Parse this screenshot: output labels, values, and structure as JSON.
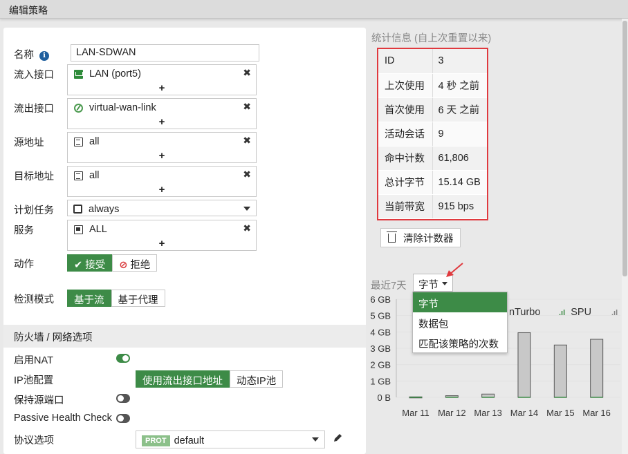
{
  "window": {
    "title": "编辑策略"
  },
  "form": {
    "name_label": "名称",
    "name_value": "LAN-SDWAN",
    "in_iface_label": "流入接口",
    "in_iface_value": "LAN (port5)",
    "out_iface_label": "流出接口",
    "out_iface_value": "virtual-wan-link",
    "src_label": "源地址",
    "src_value": "all",
    "dst_label": "目标地址",
    "dst_value": "all",
    "schedule_label": "计划任务",
    "schedule_value": "always",
    "service_label": "服务",
    "service_value": "ALL",
    "plus": "+",
    "remove": "✖",
    "action_label": "动作",
    "action_accept": "接受",
    "action_deny": "拒绝",
    "inspect_label": "检测模式",
    "inspect_flow": "基于流",
    "inspect_proxy": "基于代理",
    "section_firewall": "防火墙 / 网络选项",
    "nat_label": "启用NAT",
    "nat_on": true,
    "ippool_label": "IP池配置",
    "ippool_outiface": "使用流出接口地址",
    "ippool_dynamic": "动态IP池",
    "keep_src_port_label": "保持源端口",
    "keep_src_port_on": false,
    "passive_health_label": "Passive Health Check",
    "passive_health_on": false,
    "proto_label": "协议选项",
    "proto_badge": "PROT",
    "proto_value": "default"
  },
  "stats": {
    "title": "统计信息 (自上次重置以来)",
    "rows": [
      {
        "k": "ID",
        "v": "3"
      },
      {
        "k": "上次使用",
        "v": "4 秒 之前"
      },
      {
        "k": "首次使用",
        "v": "6 天 之前"
      },
      {
        "k": "活动会话",
        "v": "9"
      },
      {
        "k": "命中计数",
        "v": "61,806"
      },
      {
        "k": "总计字节",
        "v": "15.14 GB"
      },
      {
        "k": "当前带宽",
        "v": "915 bps"
      }
    ],
    "clear_button": "清除计数器",
    "recent_label": "最近7天",
    "metric_selected": "字节",
    "metric_options": [
      "字节",
      "数据包",
      "匹配该策略的次数"
    ],
    "legend": [
      "nTurbo",
      "SPU"
    ]
  },
  "chart_data": {
    "type": "bar",
    "categories": [
      "Mar 11",
      "Mar 12",
      "Mar 13",
      "Mar 14",
      "Mar 15",
      "Mar 16"
    ],
    "values": [
      0.03,
      0.1,
      0.2,
      3.95,
      3.2,
      3.55
    ],
    "ylabel": "",
    "yticks": [
      "0 B",
      "1 GB",
      "2 GB",
      "3 GB",
      "4 GB",
      "5 GB",
      "6 GB"
    ],
    "ylim": [
      0,
      6
    ],
    "grid": true
  },
  "colors": {
    "accent": "#3d8b47",
    "highlight_box": "#e0393e",
    "arrow": "#e0393e"
  }
}
